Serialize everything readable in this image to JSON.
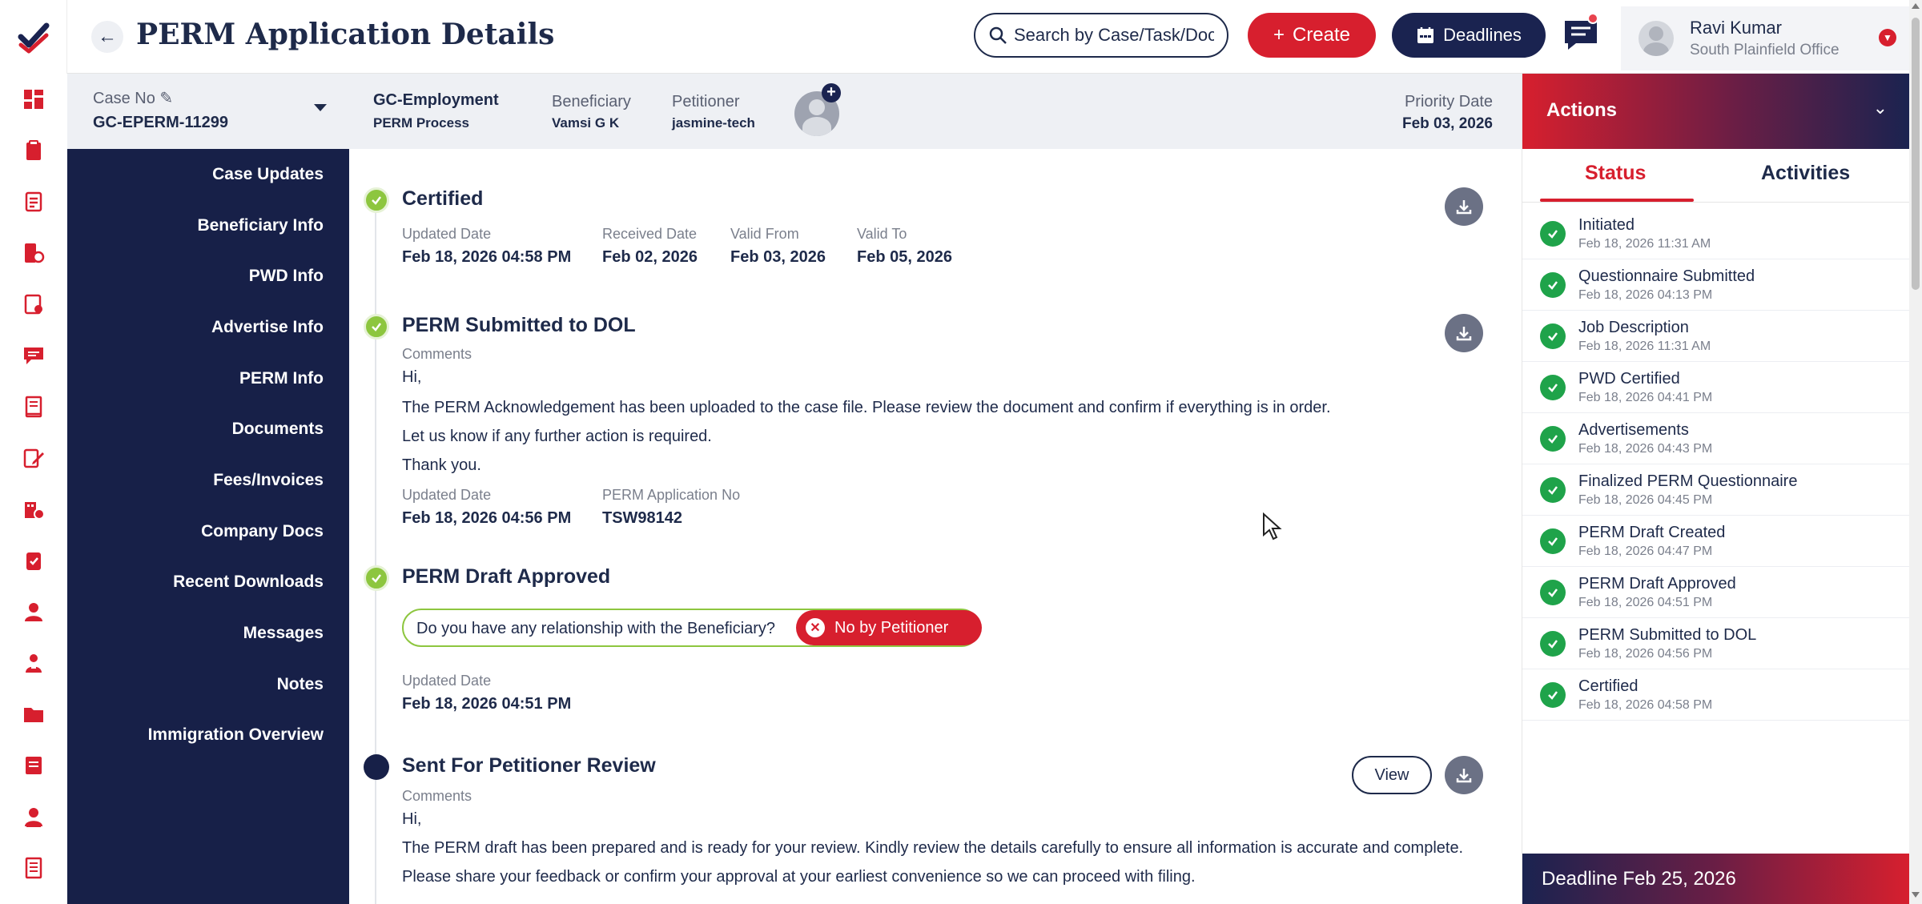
{
  "header": {
    "title": "PERM Application Details",
    "search_placeholder": "Search by Case/Task/Docu",
    "create_label": "Create",
    "deadlines_label": "Deadlines",
    "user": {
      "name": "Ravi Kumar",
      "office": "South Plainfield Office"
    }
  },
  "case_bar": {
    "case_no_label": "Case No",
    "case_no": "GC-EPERM-11299",
    "process_title": "GC-Employment",
    "process_sub": "PERM Process",
    "beneficiary_label": "Beneficiary",
    "beneficiary": "Vamsi G K",
    "petitioner_label": "Petitioner",
    "petitioner": "jasmine-tech",
    "priority_label": "Priority Date",
    "priority_date": "Feb 03, 2026"
  },
  "sidenav": {
    "items": [
      "Case Updates",
      "Beneficiary Info",
      "PWD Info",
      "Advertise Info",
      "PERM Info",
      "Documents",
      "Fees/Invoices",
      "Company Docs",
      "Recent Downloads",
      "Messages",
      "Notes",
      "Immigration Overview"
    ]
  },
  "timeline": {
    "certified": {
      "title": "Certified",
      "updated_label": "Updated Date",
      "updated": "Feb 18, 2026 04:58 PM",
      "received_label": "Received Date",
      "received": "Feb 02, 2026",
      "valid_from_label": "Valid From",
      "valid_from": "Feb 03, 2026",
      "valid_to_label": "Valid To",
      "valid_to": "Feb 05, 2026"
    },
    "submitted": {
      "title": "PERM Submitted to DOL",
      "comments_label": "Comments",
      "line1": "Hi,",
      "line2": "The PERM Acknowledgement has been uploaded to the case file. Please review the document and confirm if everything is in order.",
      "line3": "Let us know if any further action is required.",
      "line4": "Thank you.",
      "updated_label": "Updated Date",
      "updated": "Feb 18, 2026 04:56 PM",
      "app_no_label": "PERM Application No",
      "app_no": "TSW98142"
    },
    "approved": {
      "title": "PERM Draft Approved",
      "question": "Do you have any relationship with the Beneficiary?",
      "answer": "No by Petitioner",
      "updated_label": "Updated Date",
      "updated": "Feb 18, 2026 04:51 PM"
    },
    "review": {
      "title": "Sent For Petitioner Review",
      "view_label": "View",
      "comments_label": "Comments",
      "line1": "Hi,",
      "line2": "The PERM draft has been prepared and is ready for your review. Kindly review the details carefully to ensure all information is accurate and complete.",
      "line3": "Please share your feedback or confirm your approval at your earliest convenience so we can proceed with filing."
    }
  },
  "actions": {
    "title": "Actions",
    "tab_status": "Status",
    "tab_activities": "Activities",
    "statuses": [
      {
        "name": "Initiated",
        "date": "Feb 18, 2026 11:31 AM"
      },
      {
        "name": "Questionnaire Submitted",
        "date": "Feb 18, 2026 04:13 PM"
      },
      {
        "name": "Job Description",
        "date": "Feb 18, 2026 11:31 AM"
      },
      {
        "name": "PWD Certified",
        "date": "Feb 18, 2026 04:41 PM"
      },
      {
        "name": "Advertisements",
        "date": "Feb 18, 2026 04:43 PM"
      },
      {
        "name": "Finalized PERM Questionnaire",
        "date": "Feb 18, 2026 04:45 PM"
      },
      {
        "name": "PERM Draft Created",
        "date": "Feb 18, 2026 04:47 PM"
      },
      {
        "name": "PERM Draft Approved",
        "date": "Feb 18, 2026 04:51 PM"
      },
      {
        "name": "PERM Submitted to DOL",
        "date": "Feb 18, 2026 04:56 PM"
      },
      {
        "name": "Certified",
        "date": "Feb 18, 2026 04:58 PM"
      }
    ],
    "deadline": "Deadline Feb 25, 2026"
  },
  "colors": {
    "navy": "#1a2350",
    "red": "#d71f2e",
    "green_check": "#1fa34a",
    "timeline_check": "#8dc63f"
  },
  "icons": {
    "rail": [
      "dashboard-icon",
      "clipboard-icon",
      "document-list-icon",
      "case-file-icon",
      "doc-check-icon",
      "chat-icon",
      "notebook-icon",
      "edit-doc-icon",
      "building-icon",
      "task-icon",
      "user-icon",
      "team-icon",
      "folder-icon",
      "notes-icon",
      "person-icon",
      "ledger-icon"
    ]
  }
}
